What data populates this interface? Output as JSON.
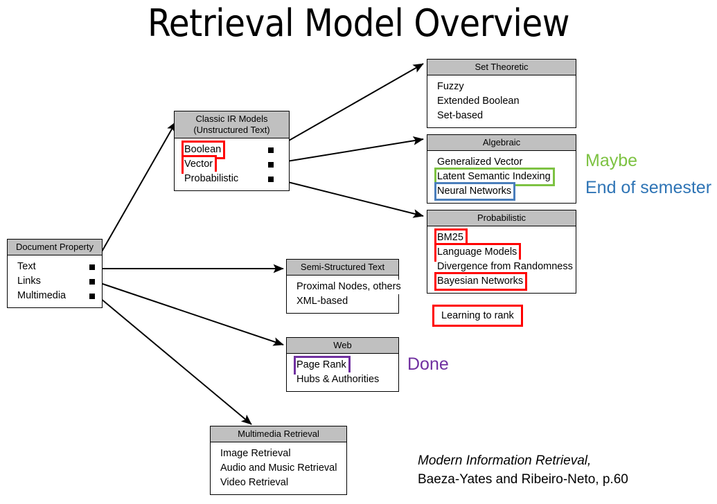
{
  "slide": {
    "title": "Retrieval Model Overview"
  },
  "nodes": {
    "document_property": {
      "header": [
        "Document Property"
      ],
      "items": [
        {
          "label": "Text",
          "highlight": "none",
          "bullet": true
        },
        {
          "label": "Links",
          "highlight": "none",
          "bullet": true
        },
        {
          "label": "Multimedia",
          "highlight": "none",
          "bullet": true
        }
      ]
    },
    "classic_ir": {
      "header": [
        "Classic IR Models",
        "(Unstructured Text)"
      ],
      "items": [
        {
          "label": "Boolean",
          "highlight": "red",
          "bullet": true
        },
        {
          "label": "Vector",
          "highlight": "red",
          "bullet": true
        },
        {
          "label": "Probabilistic",
          "highlight": "none",
          "bullet": true
        }
      ]
    },
    "set_theoretic": {
      "header": [
        "Set Theoretic"
      ],
      "items": [
        {
          "label": "Fuzzy",
          "highlight": "none",
          "bullet": false
        },
        {
          "label": "Extended Boolean",
          "highlight": "none",
          "bullet": false
        },
        {
          "label": "Set-based",
          "highlight": "none",
          "bullet": false
        }
      ]
    },
    "algebraic": {
      "header": [
        "Algebraic"
      ],
      "items": [
        {
          "label": "Generalized Vector",
          "highlight": "none",
          "bullet": false
        },
        {
          "label": "Latent Semantic Indexing",
          "highlight": "green",
          "bullet": false
        },
        {
          "label": "Neural Networks",
          "highlight": "blue",
          "bullet": false
        }
      ]
    },
    "probabilistic": {
      "header": [
        "Probabilistic"
      ],
      "items": [
        {
          "label": "BM25",
          "highlight": "red",
          "bullet": false
        },
        {
          "label": "Language Models",
          "highlight": "red",
          "bullet": false
        },
        {
          "label": "Divergence from Randomness",
          "highlight": "none",
          "bullet": false
        },
        {
          "label": "Bayesian Networks",
          "highlight": "red",
          "bullet": false
        }
      ]
    },
    "semi_structured": {
      "header": [
        "Semi-Structured Text"
      ],
      "items": [
        {
          "label": "Proximal Nodes, others",
          "highlight": "none",
          "bullet": false
        },
        {
          "label": "XML-based",
          "highlight": "none",
          "bullet": false
        }
      ]
    },
    "web": {
      "header": [
        "Web"
      ],
      "items": [
        {
          "label": "Page Rank",
          "highlight": "purple",
          "bullet": false
        },
        {
          "label": "Hubs & Authorities",
          "highlight": "none",
          "bullet": false
        }
      ]
    },
    "multimedia_retrieval": {
      "header": [
        "Multimedia Retrieval"
      ],
      "items": [
        {
          "label": "Image Retrieval",
          "highlight": "none",
          "bullet": false
        },
        {
          "label": "Audio and Music Retrieval",
          "highlight": "none",
          "bullet": false
        },
        {
          "label": "Video Retrieval",
          "highlight": "none",
          "bullet": false
        }
      ]
    }
  },
  "callouts": {
    "learning_to_rank": {
      "label": "Learning to rank",
      "border_color": "#ff0000"
    }
  },
  "annotations": [
    {
      "key": "maybe",
      "label": "Maybe",
      "color": "#7dc242"
    },
    {
      "key": "end_of_semester",
      "label": "End of semester",
      "color": "#2e74b5"
    },
    {
      "key": "done",
      "label": "Done",
      "color": "#7030a0"
    }
  ],
  "citation": {
    "title": "Modern Information Retrieval,",
    "authors": "Baeza-Yates and Ribeiro-Neto, p.60"
  },
  "colors": {
    "header_fill": "#c0c0c0",
    "outline": "#000000",
    "red": "#ff0000",
    "green": "#7dc242",
    "blue": "#4a7ebb",
    "purple": "#7030a0",
    "annotation_blue": "#2e74b5"
  }
}
